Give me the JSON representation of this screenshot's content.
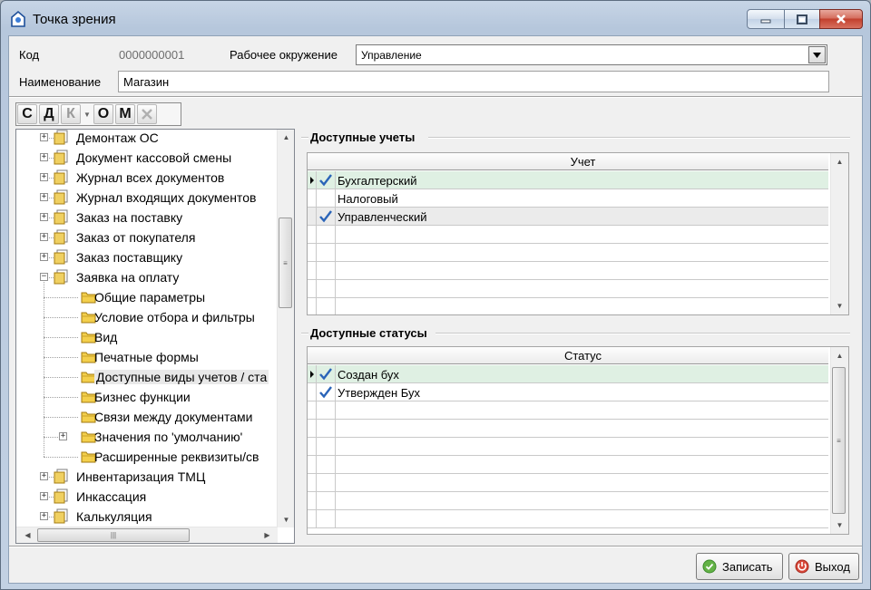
{
  "window": {
    "title": "Точка зрения"
  },
  "form": {
    "code_label": "Код",
    "code_value": "0000000001",
    "env_label": "Рабочее окружение",
    "env_value": "Управление",
    "name_label": "Наименование",
    "name_value": "Магазин"
  },
  "toolbar": {
    "buttons": [
      {
        "label": "С",
        "enabled": true
      },
      {
        "label": "Д",
        "enabled": true
      },
      {
        "label": "К",
        "enabled": false
      },
      {
        "label": "О",
        "enabled": true
      },
      {
        "label": "М",
        "enabled": true
      }
    ]
  },
  "tree": {
    "items": [
      {
        "label": "Демонтаж ОС",
        "level": 0,
        "expander": "+"
      },
      {
        "label": "Документ кассовой смены",
        "level": 0,
        "expander": "+"
      },
      {
        "label": "Журнал всех документов",
        "level": 0,
        "expander": "+"
      },
      {
        "label": "Журнал входящих документов",
        "level": 0,
        "expander": "+"
      },
      {
        "label": "Заказ на поставку",
        "level": 0,
        "expander": "+"
      },
      {
        "label": "Заказ от покупателя",
        "level": 0,
        "expander": "+"
      },
      {
        "label": "Заказ поставщику",
        "level": 0,
        "expander": "+"
      },
      {
        "label": "Заявка на оплату",
        "level": 0,
        "expander": "-"
      },
      {
        "label": "Общие параметры",
        "level": 1,
        "expander": ""
      },
      {
        "label": "Условие отбора и фильтры",
        "level": 1,
        "expander": ""
      },
      {
        "label": "Вид",
        "level": 1,
        "expander": ""
      },
      {
        "label": "Печатные формы",
        "level": 1,
        "expander": ""
      },
      {
        "label": "Доступные виды учетов / ста",
        "level": 1,
        "expander": "",
        "selected": true
      },
      {
        "label": "Бизнес функции",
        "level": 1,
        "expander": ""
      },
      {
        "label": "Связи между документами",
        "level": 1,
        "expander": ""
      },
      {
        "label": "Значения по 'умолчанию'",
        "level": 1,
        "expander": "+"
      },
      {
        "label": "Расширенные реквизиты/св",
        "level": 1,
        "expander": ""
      },
      {
        "label": "Инвентаризация ТМЦ",
        "level": 0,
        "expander": "+"
      },
      {
        "label": "Инкассация",
        "level": 0,
        "expander": "+"
      },
      {
        "label": "Калькуляция",
        "level": 0,
        "expander": "+"
      }
    ]
  },
  "accounts": {
    "title": "Доступные учеты",
    "column": "Учет",
    "rows": [
      {
        "label": "Бухгалтерский",
        "checked": true,
        "current": true
      },
      {
        "label": "Налоговый",
        "checked": false,
        "current": false
      },
      {
        "label": "Управленческий",
        "checked": true,
        "current": false
      }
    ]
  },
  "statuses": {
    "title": "Доступные статусы",
    "column": "Статус",
    "rows": [
      {
        "label": "Создан бух",
        "checked": true,
        "current": true
      },
      {
        "label": "Утвержден Бух",
        "checked": true,
        "current": false
      }
    ]
  },
  "buttons": {
    "save": "Записать",
    "exit": "Выход"
  },
  "colors": {
    "current_row": "#dff0e3",
    "alt_row": "#ebebeb",
    "check": "#2a64b8"
  }
}
